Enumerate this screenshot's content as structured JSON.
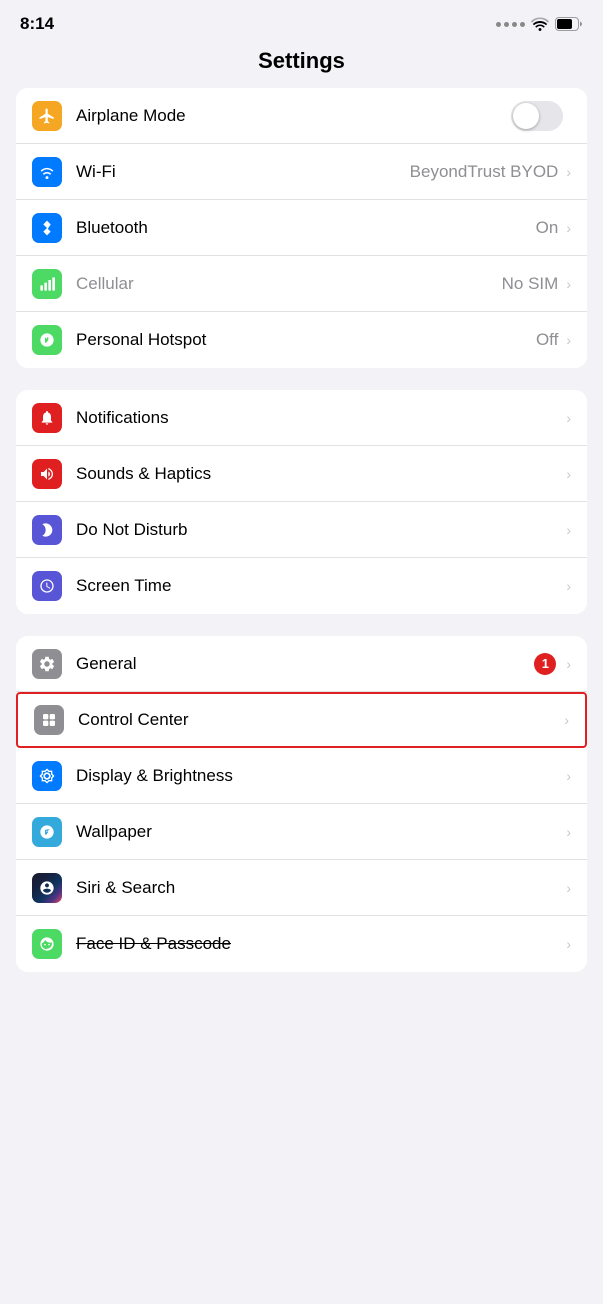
{
  "statusBar": {
    "time": "8:14"
  },
  "pageTitle": "Settings",
  "groups": [
    {
      "id": "network",
      "items": [
        {
          "id": "airplane-mode",
          "label": "Airplane Mode",
          "iconBg": "#f5a623",
          "iconType": "airplane",
          "hasToggle": true,
          "toggleOn": false,
          "value": "",
          "hasChevron": false
        },
        {
          "id": "wifi",
          "label": "Wi-Fi",
          "iconBg": "#007aff",
          "iconType": "wifi",
          "hasToggle": false,
          "value": "BeyondTrust BYOD",
          "hasChevron": true
        },
        {
          "id": "bluetooth",
          "label": "Bluetooth",
          "iconBg": "#007aff",
          "iconType": "bluetooth",
          "hasToggle": false,
          "value": "On",
          "hasChevron": true
        },
        {
          "id": "cellular",
          "label": "Cellular",
          "iconBg": "#4cd964",
          "iconType": "cellular",
          "dimLabel": true,
          "hasToggle": false,
          "value": "No SIM",
          "hasChevron": true
        },
        {
          "id": "personal-hotspot",
          "label": "Personal Hotspot",
          "iconBg": "#4cd964",
          "iconType": "hotspot",
          "hasToggle": false,
          "value": "Off",
          "hasChevron": true
        }
      ]
    },
    {
      "id": "notifications",
      "items": [
        {
          "id": "notifications",
          "label": "Notifications",
          "iconBg": "#e02020",
          "iconType": "notifications",
          "hasToggle": false,
          "value": "",
          "hasChevron": true
        },
        {
          "id": "sounds-haptics",
          "label": "Sounds & Haptics",
          "iconBg": "#e02020",
          "iconType": "sounds",
          "hasToggle": false,
          "value": "",
          "hasChevron": true
        },
        {
          "id": "do-not-disturb",
          "label": "Do Not Disturb",
          "iconBg": "#5856d6",
          "iconType": "moon",
          "hasToggle": false,
          "value": "",
          "hasChevron": true
        },
        {
          "id": "screen-time",
          "label": "Screen Time",
          "iconBg": "#5856d6",
          "iconType": "screentime",
          "hasToggle": false,
          "value": "",
          "hasChevron": true
        }
      ]
    },
    {
      "id": "system",
      "items": [
        {
          "id": "general",
          "label": "General",
          "iconBg": "#8e8e93",
          "iconType": "gear",
          "hasToggle": false,
          "value": "",
          "hasBadge": true,
          "badgeValue": "1",
          "hasChevron": true
        },
        {
          "id": "control-center",
          "label": "Control Center",
          "iconBg": "#8e8e93",
          "iconType": "controlcenter",
          "hasToggle": false,
          "value": "",
          "hasChevron": true,
          "highlighted": true
        },
        {
          "id": "display-brightness",
          "label": "Display & Brightness",
          "iconBg": "#007aff",
          "iconType": "display",
          "hasToggle": false,
          "value": "",
          "hasChevron": true
        },
        {
          "id": "wallpaper",
          "label": "Wallpaper",
          "iconBg": "#34aadc",
          "iconType": "wallpaper",
          "hasToggle": false,
          "value": "",
          "hasChevron": true
        },
        {
          "id": "siri-search",
          "label": "Siri & Search",
          "iconBg": "gradient-siri",
          "iconType": "siri",
          "hasToggle": false,
          "value": "",
          "hasChevron": true
        },
        {
          "id": "face-id",
          "label": "Face ID & Passcode",
          "iconBg": "#4cd964",
          "iconType": "faceid",
          "hasToggle": false,
          "value": "",
          "hasChevron": true,
          "strikethrough": true
        }
      ]
    }
  ]
}
